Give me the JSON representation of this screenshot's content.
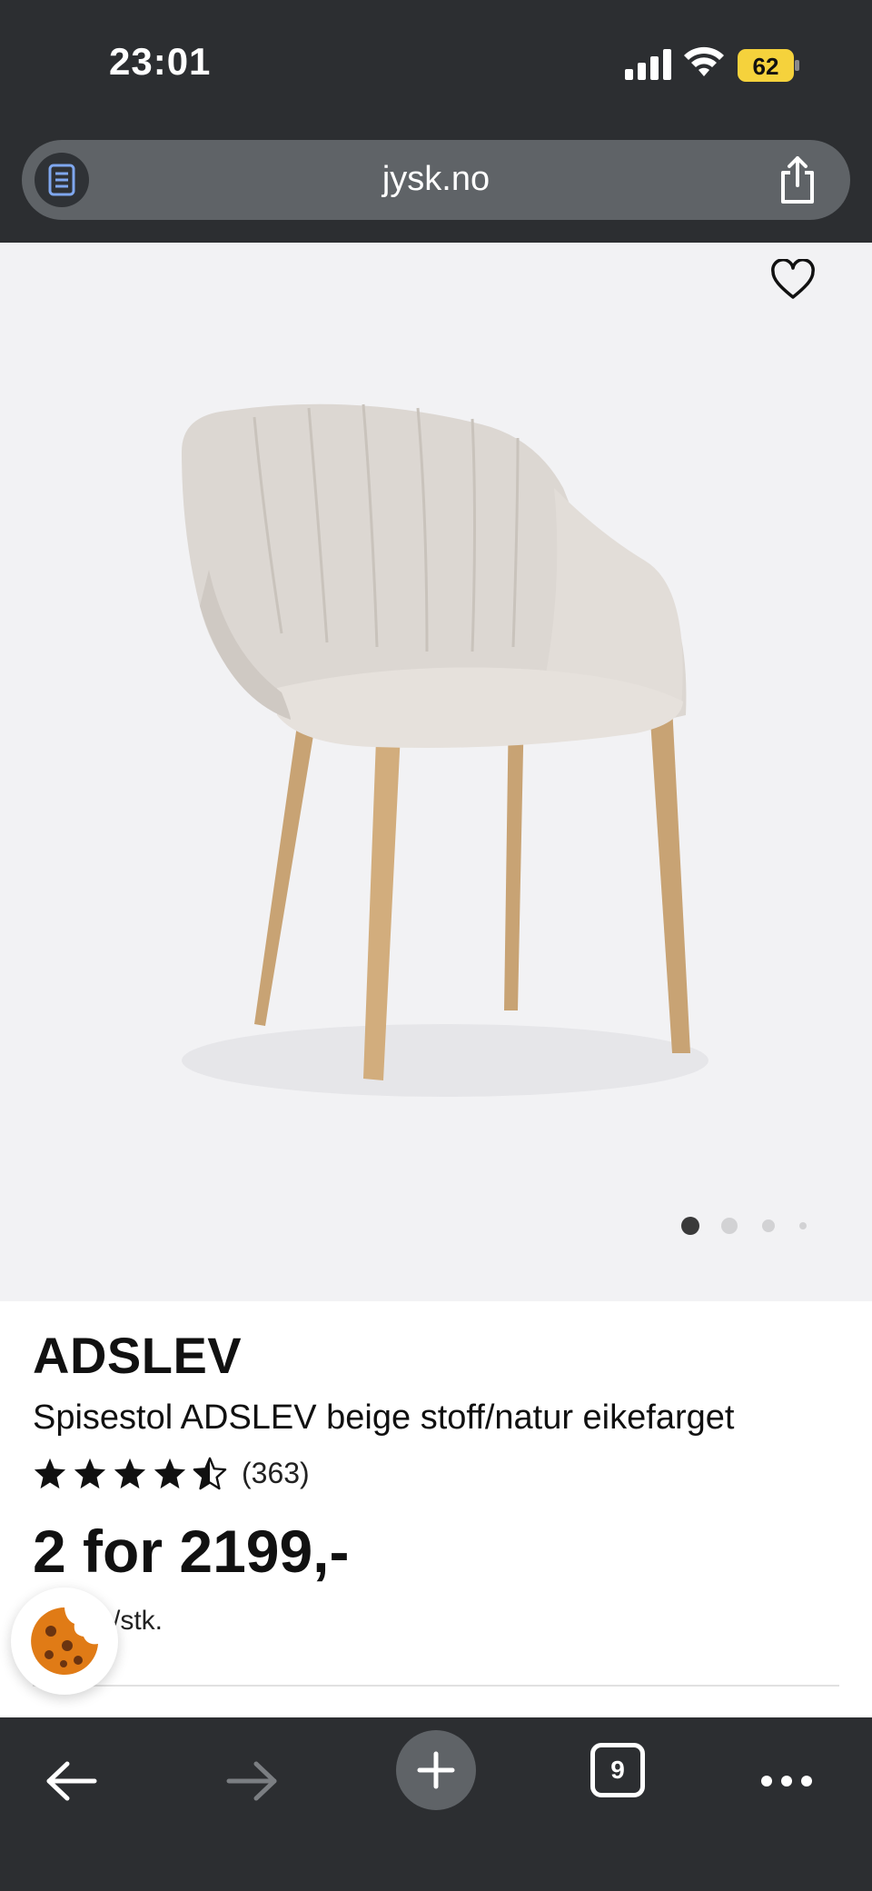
{
  "status_bar": {
    "time": "23:01",
    "battery_level": "62",
    "icons": [
      "signal-icon",
      "wifi-icon",
      "battery-icon"
    ]
  },
  "address_bar": {
    "url": "jysk.no",
    "icons": [
      "reader-icon",
      "share-icon"
    ]
  },
  "product": {
    "brand": "ADSLEV",
    "description": "Spisestol ADSLEV beige stoff/natur eikefarget",
    "rating_stars": 4.5,
    "rating_count": "(363)",
    "price": "2 for 2199,-",
    "unit_text": "/stk.",
    "image_page": 1,
    "image_total": 4
  },
  "toolbar": {
    "tab_count": "9",
    "icons": [
      "back-icon",
      "forward-icon",
      "plus-icon",
      "tabs-icon",
      "more-icon"
    ]
  },
  "colors": {
    "chrome_bg": "#2c2e31",
    "pill_bg": "#5f6367",
    "battery_badge": "#f5d23c",
    "hero_bg": "#f2f2f4",
    "text": "#111111"
  }
}
